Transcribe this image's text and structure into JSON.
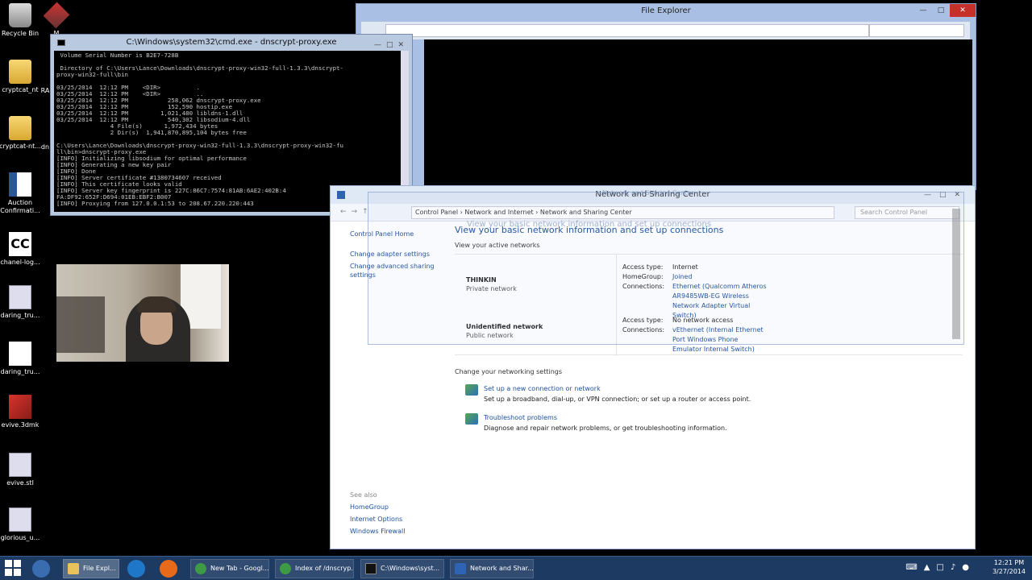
{
  "desktop": {
    "icons": [
      {
        "label": "Recycle Bin"
      },
      {
        "label": "cryptcat_nt"
      },
      {
        "label": "cryptcat-nt..."
      },
      {
        "label": "Auction Confirmati..."
      },
      {
        "label": "chanel-log..."
      },
      {
        "label": "daring_tru..."
      },
      {
        "label": "daring_tru..."
      },
      {
        "label": "evive.3dmk"
      },
      {
        "label": "evive.stl"
      },
      {
        "label": "glorious_u..."
      }
    ],
    "partial_labels": [
      "M",
      "RA",
      "dn"
    ]
  },
  "cmd": {
    "title": "C:\\Windows\\system32\\cmd.exe - dnscrypt-proxy.exe",
    "output": " Volume Serial Number is B2E7-728B\n\n Directory of C:\\Users\\Lance\\Downloads\\dnscrypt-proxy-win32-full-1.3.3\\dnscrypt-\nproxy-win32-full\\bin\n\n03/25/2014  12:12 PM    <DIR>          .\n03/25/2014  12:12 PM    <DIR>          ..\n03/25/2014  12:12 PM           258,062 dnscrypt-proxy.exe\n03/25/2014  12:12 PM           152,590 hostip.exe\n03/25/2014  12:12 PM         1,021,480 libldns-1.dll\n03/25/2014  12:12 PM           540,302 libsodium-4.dll\n               4 File(s)      1,972,434 bytes\n               2 Dir(s)  1,941,870,895,104 bytes free\n\nC:\\Users\\Lance\\Downloads\\dnscrypt-proxy-win32-full-1.3.3\\dnscrypt-proxy-win32-fu\nll\\bin>dnscrypt-proxy.exe\n[INFO] Initializing libsodium for optimal performance\n[INFO] Generating a new key pair\n[INFO] Done\n[INFO] Server certificate #1380734607 received\n[INFO] This certificate looks valid\n[INFO] Server key fingerprint is 227C:86C7:7574:81AB:6AE2:402B:4\nFA:DF92:652F:D694:01EB:EBF2:B007\n[INFO] Proxying from 127.0.0.1:53 to 208.67.220.220:443"
  },
  "file_explorer": {
    "title": "File Explorer"
  },
  "nsc": {
    "title": "Network and Sharing Center",
    "breadcrumb": "Control Panel  ›  Network and Internet  ›  Network and Sharing Center",
    "search_placeholder": "Search Control Panel",
    "left": {
      "home": "Control Panel Home",
      "adapter": "Change adapter settings",
      "advanced": "Change advanced sharing settings"
    },
    "see_also": {
      "header": "See also",
      "links": [
        "HomeGroup",
        "Internet Options",
        "Windows Firewall"
      ]
    },
    "heading": "View your basic network information and set up connections",
    "active_header": "View your active networks",
    "networks": [
      {
        "name": "THINKIN",
        "type": "Private network",
        "access_label": "Access type:",
        "access_value": "Internet",
        "homegroup_label": "HomeGroup:",
        "homegroup_value": "Joined",
        "connections_label": "Connections:",
        "connections_value": "Ethernet (Qualcomm Atheros AR9485WB-EG Wireless Network Adapter Virtual Switch)"
      },
      {
        "name": "Unidentified network",
        "type": "Public network",
        "access_label": "Access type:",
        "access_value": "No network access",
        "connections_label": "Connections:",
        "connections_value": "vEthernet (Internal Ethernet Port Windows Phone Emulator Internal Switch)"
      }
    ],
    "settings_header": "Change your networking settings",
    "settings": [
      {
        "link": "Set up a new connection or network",
        "desc": "Set up a broadband, dial-up, or VPN connection; or set up a router or access point."
      },
      {
        "link": "Troubleshoot problems",
        "desc": "Diagnose and repair network problems, or get troubleshooting information."
      }
    ]
  },
  "taskbar": {
    "buttons": [
      {
        "label": "File Expl...",
        "color": "#e8c25a"
      },
      {
        "label": "New Tab - Googl...",
        "color": "#3d9a45"
      },
      {
        "label": "Index of /dnscryp...",
        "color": "#3d9a45"
      },
      {
        "label": "C:\\Windows\\syst...",
        "color": "#111111"
      },
      {
        "label": "Network and Shar...",
        "color": "#2f63b4"
      }
    ],
    "time": "12:21 PM",
    "date": "3/27/2014"
  }
}
